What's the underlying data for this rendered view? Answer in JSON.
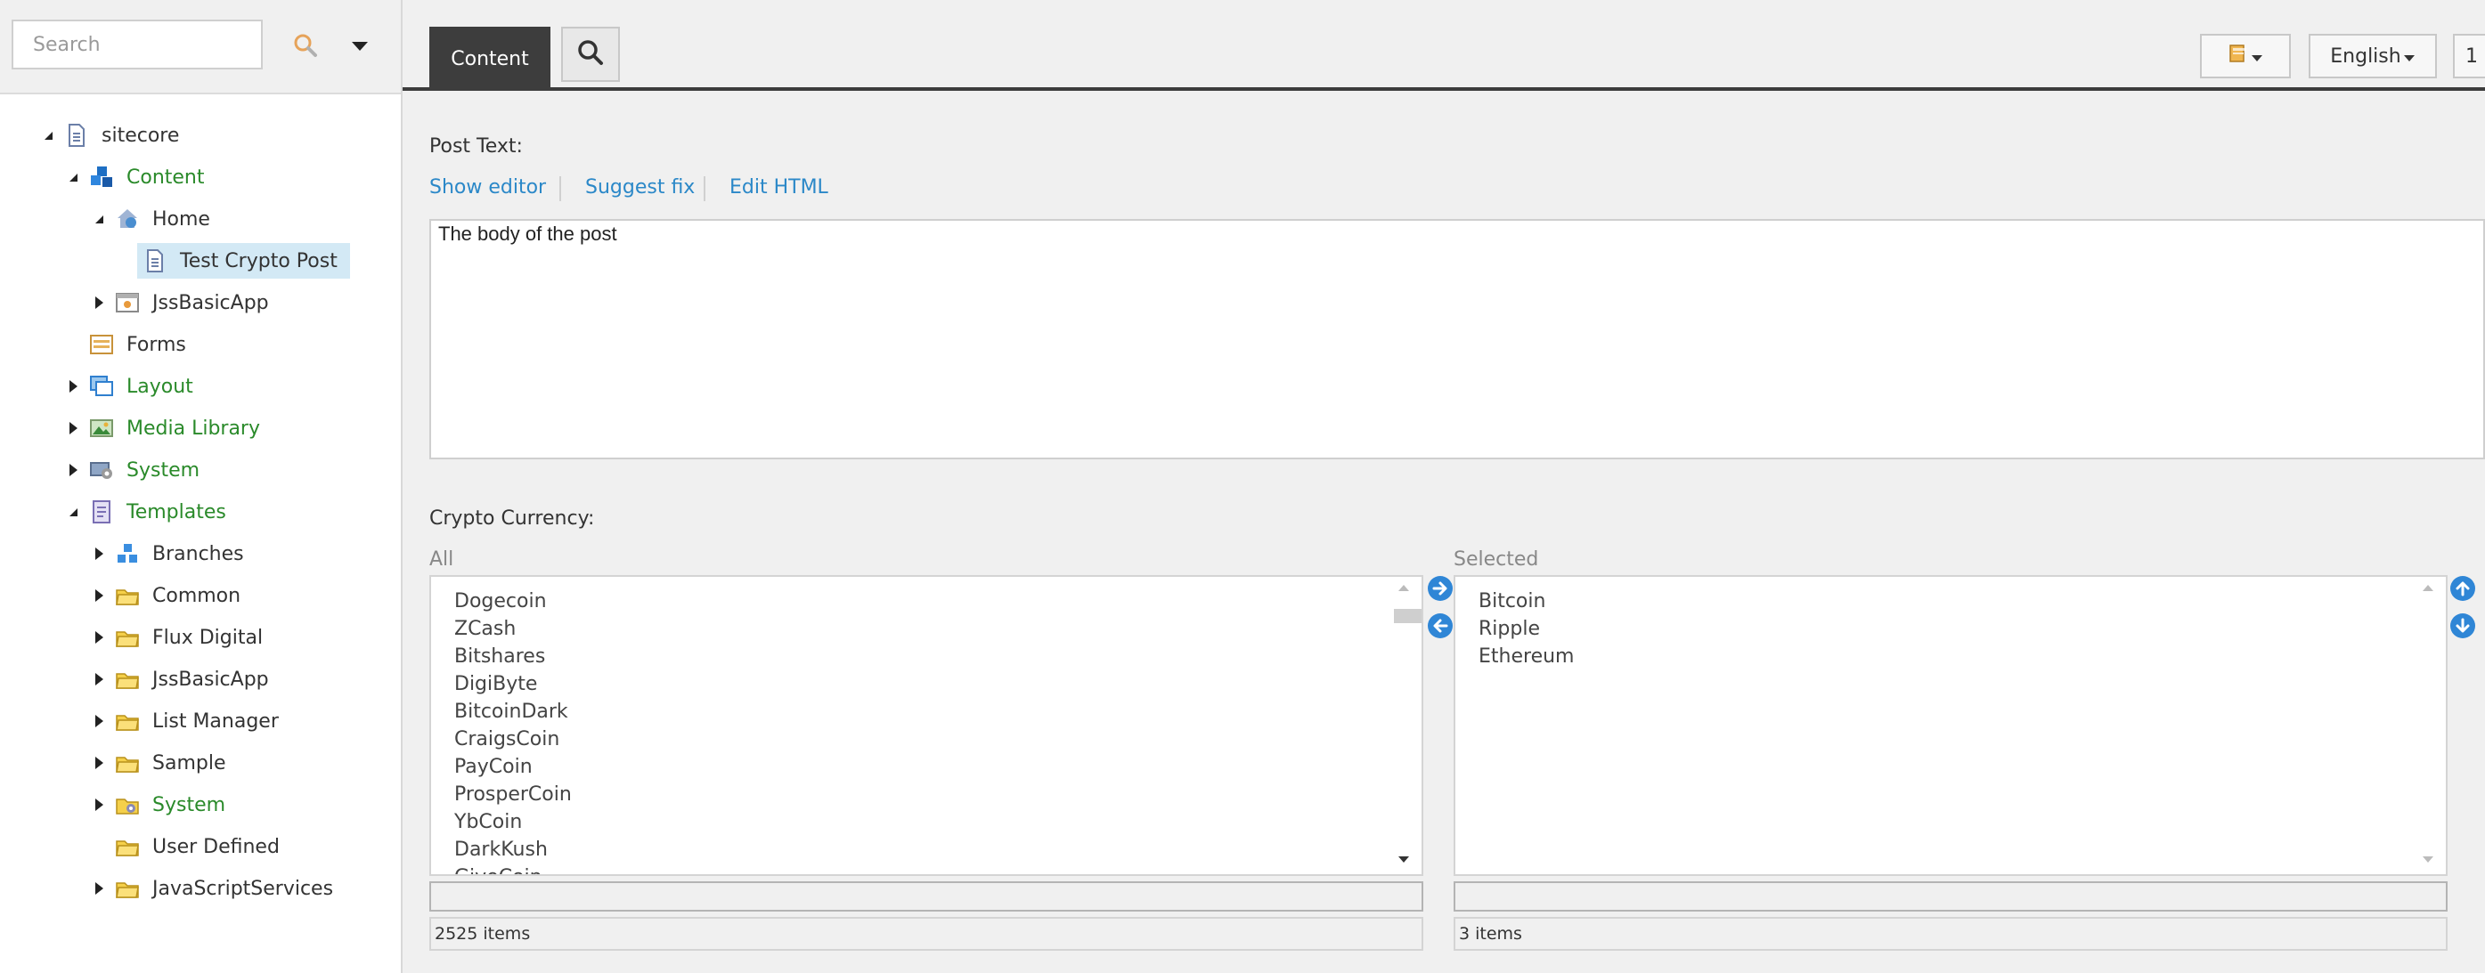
{
  "sidebar": {
    "search": {
      "placeholder": "Search"
    },
    "tree": [
      {
        "label": "sitecore",
        "icon": "document-icon",
        "style": "normal"
      },
      {
        "label": "Content",
        "icon": "content-cubes-icon",
        "style": "green"
      },
      {
        "label": "Home",
        "icon": "home-globe-icon",
        "style": "normal"
      },
      {
        "label": "Test Crypto Post",
        "icon": "document-icon",
        "style": "selected"
      },
      {
        "label": "JssBasicApp",
        "icon": "app-window-icon",
        "style": "normal"
      },
      {
        "label": "Forms",
        "icon": "forms-icon",
        "style": "normal"
      },
      {
        "label": "Layout",
        "icon": "layout-icon",
        "style": "green"
      },
      {
        "label": "Media Library",
        "icon": "media-library-icon",
        "style": "green"
      },
      {
        "label": "System",
        "icon": "system-icon",
        "style": "green"
      },
      {
        "label": "Templates",
        "icon": "templates-icon",
        "style": "green"
      },
      {
        "label": "Branches",
        "icon": "branches-icon",
        "style": "normal"
      },
      {
        "label": "Common",
        "icon": "folder-icon",
        "style": "normal"
      },
      {
        "label": "Flux Digital",
        "icon": "folder-icon",
        "style": "normal"
      },
      {
        "label": "JssBasicApp",
        "icon": "folder-icon",
        "style": "normal"
      },
      {
        "label": "List Manager",
        "icon": "folder-icon",
        "style": "normal"
      },
      {
        "label": "Sample",
        "icon": "folder-icon",
        "style": "normal"
      },
      {
        "label": "System",
        "icon": "system-folder-icon",
        "style": "green"
      },
      {
        "label": "User Defined",
        "icon": "folder-icon",
        "style": "normal"
      },
      {
        "label": "JavaScriptServices",
        "icon": "folder-icon",
        "style": "normal"
      }
    ]
  },
  "toolbar": {
    "content_tab": "Content",
    "language": "English",
    "partial_button": "1"
  },
  "fields": {
    "post_text": {
      "label": "Post Text:",
      "links": [
        "Show editor",
        "Suggest fix",
        "Edit HTML"
      ],
      "value": "The body of the post"
    },
    "crypto": {
      "label": "Crypto Currency:",
      "all_caption": "All",
      "selected_caption": "Selected",
      "all_items": [
        "Dogecoin",
        "ZCash",
        "Bitshares",
        "DigiByte",
        "BitcoinDark",
        "CraigsCoin",
        "PayCoin",
        "ProsperCoin",
        "YbCoin",
        "DarkKush",
        "GiveCoin"
      ],
      "selected_items": [
        "Bitcoin",
        "Ripple",
        "Ethereum"
      ],
      "all_count": "2525 items",
      "selected_count": "3 items"
    }
  },
  "colors": {
    "accent_link": "#2b88c8",
    "tree_green": "#2a8a2a",
    "selection": "#d3e9f5",
    "tab_dark": "#3d3d3d"
  }
}
